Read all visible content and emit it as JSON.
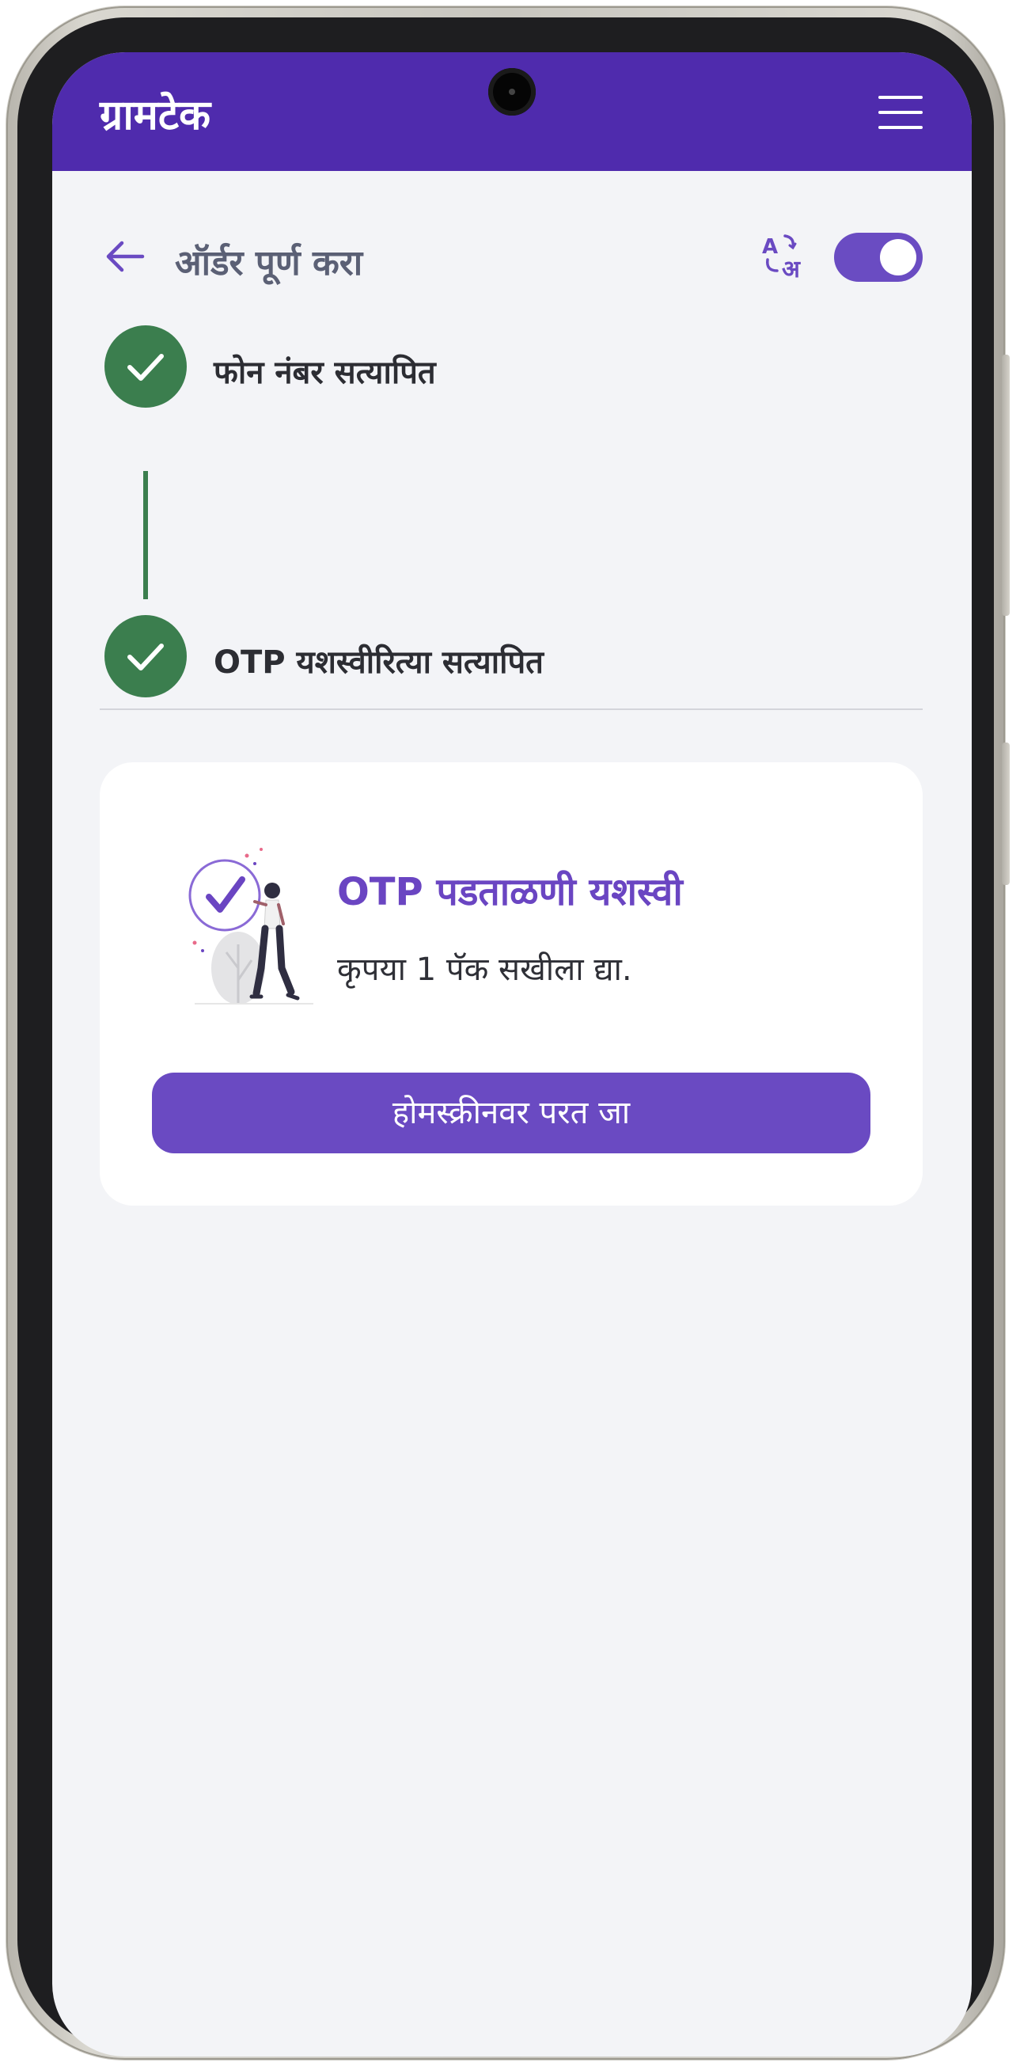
{
  "app": {
    "brand": "ग्रामटेक",
    "menu_icon": "hamburger-menu-icon"
  },
  "header": {
    "back_icon": "arrow-left-icon",
    "title": "ऑर्डर पूर्ण करा",
    "translate_icon": "translate-icon",
    "language_toggle_on": true
  },
  "steps": [
    {
      "label": "फोन नंबर सत्यापित",
      "status": "done",
      "icon": "check-icon"
    },
    {
      "label": "OTP यशस्वीरित्या सत्यापित",
      "status": "done",
      "icon": "check-icon"
    }
  ],
  "card": {
    "illustration": "verified-illustration",
    "title": "OTP पडताळणी यशस्वी",
    "message": "कृपया 1 पॅक सखीला द्या.",
    "button_label": "होमस्क्रीनवर परत जा"
  },
  "colors": {
    "app_bar": "#4f2bad",
    "accent": "#6a4ac2",
    "success": "#3b7e4e",
    "background": "#f3f4f7"
  }
}
